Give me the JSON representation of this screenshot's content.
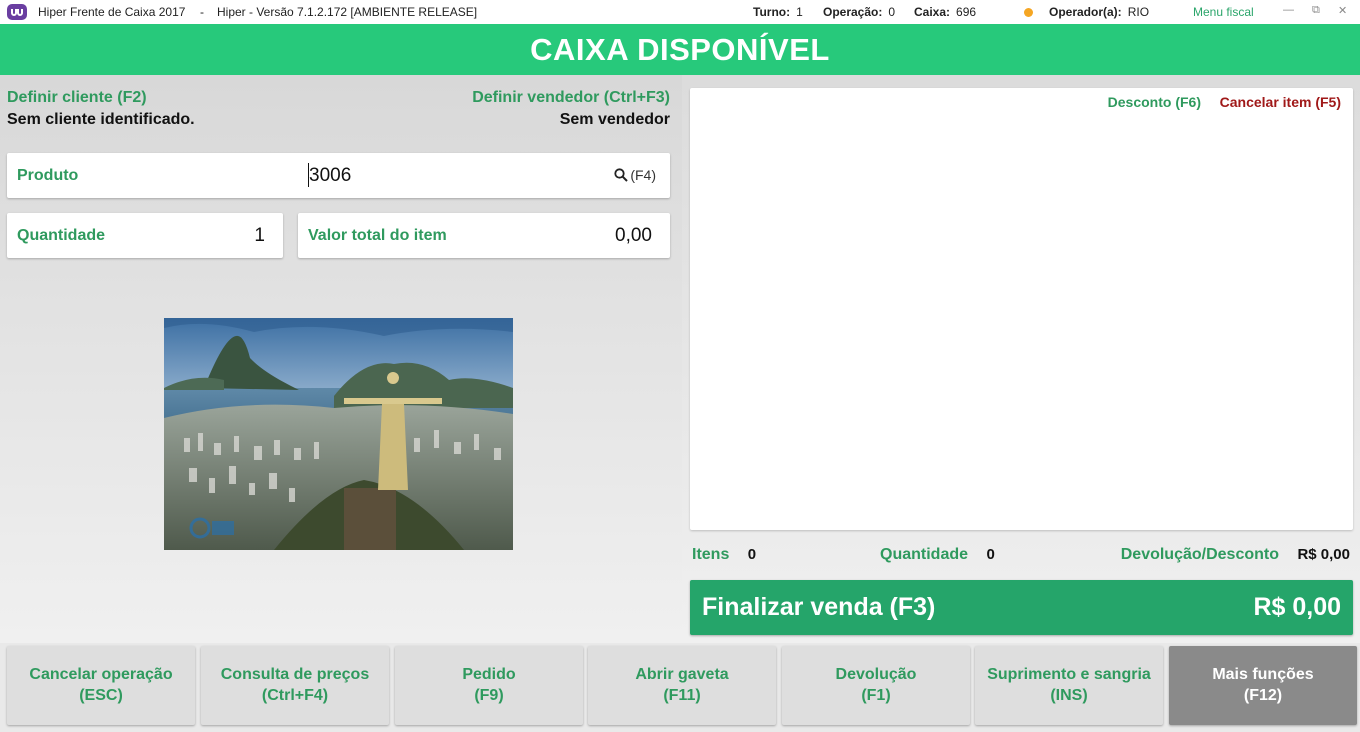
{
  "titlebar": {
    "app_title": "Hiper Frente de Caixa 2017",
    "separator": "-",
    "version": "Hiper - Versão 7.1.2.172 [AMBIENTE RELEASE]",
    "turno_label": "Turno:",
    "turno_value": "1",
    "operacao_label": "Operação:",
    "operacao_value": "0",
    "caixa_label": "Caixa:",
    "caixa_value": "696",
    "operador_label": "Operador(a):",
    "operador_value": "RIO",
    "menu_fiscal": "Menu fiscal",
    "status_color": "#f5a623"
  },
  "header": {
    "title": "CAIXA DISPONÍVEL",
    "color": "#27c97b"
  },
  "client": {
    "define_label": "Definir cliente (F2)",
    "status": "Sem cliente identificado."
  },
  "seller": {
    "define_label": "Definir vendedor (Ctrl+F3)",
    "status": "Sem vendedor"
  },
  "product": {
    "label": "Produto",
    "value": "3006",
    "search_shortcut": "(F4)"
  },
  "quantity": {
    "label": "Quantidade",
    "value": "1"
  },
  "item_total": {
    "label": "Valor total do item",
    "value": "0,00"
  },
  "item_list": {
    "discount_link": "Desconto (F6)",
    "cancel_item_link": "Cancelar item (F5)"
  },
  "summary": {
    "items_label": "Itens",
    "items_value": "0",
    "quantity_label": "Quantidade",
    "quantity_value": "0",
    "return_label": "Devolução/Desconto",
    "return_value": "R$ 0,00"
  },
  "finalize": {
    "label": "Finalizar venda (F3)",
    "total": "R$ 0,00",
    "color": "#25a56a"
  },
  "function_buttons": [
    {
      "line1": "Cancelar operação",
      "line2": "(ESC)"
    },
    {
      "line1": "Consulta de preços",
      "line2": "(Ctrl+F4)"
    },
    {
      "line1": "Pedido",
      "line2": "(F9)"
    },
    {
      "line1": "Abrir gaveta",
      "line2": "(F11)"
    },
    {
      "line1": "Devolução",
      "line2": "(F1)"
    },
    {
      "line1": "Suprimento e sangria",
      "line2": "(INS)"
    },
    {
      "line1": "Mais funções",
      "line2": "(F12)"
    }
  ]
}
